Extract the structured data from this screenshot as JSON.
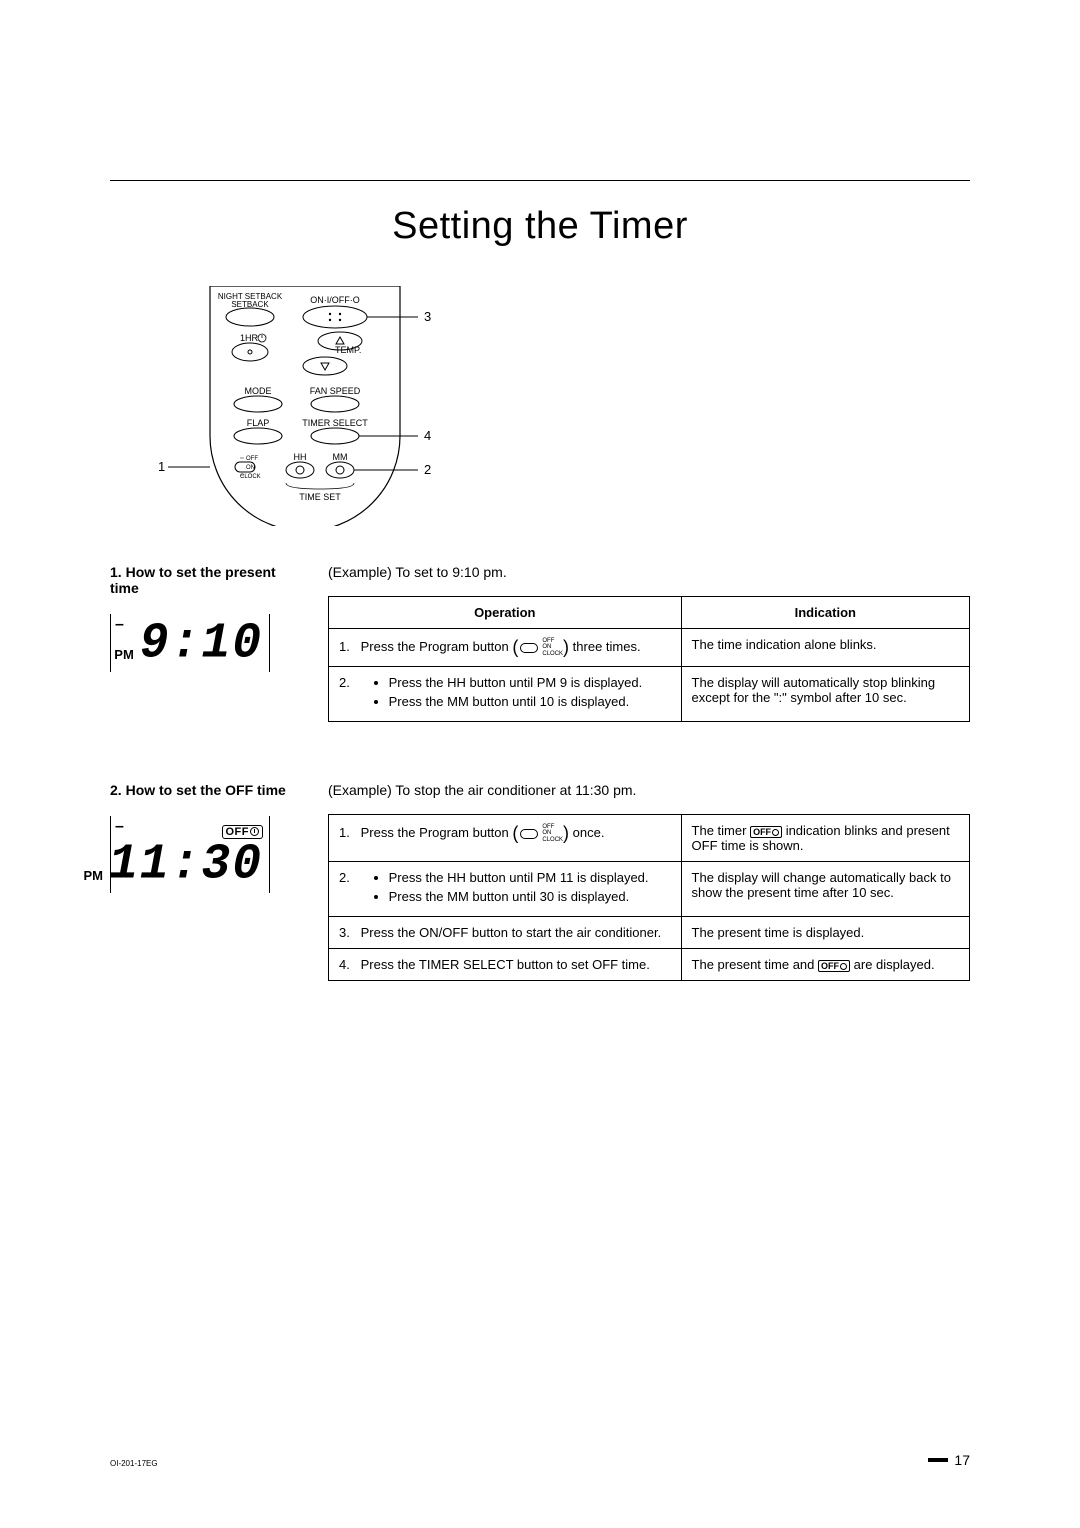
{
  "title": "Setting the Timer",
  "remote": {
    "labels": {
      "night_setback": "NIGHT\nSETBACK",
      "on_off": "ON·I/OFF·O",
      "one_hr": "1HR.",
      "temp": "TEMP.",
      "mode": "MODE",
      "fan_speed": "FAN SPEED",
      "flap": "FLAP",
      "timer_select": "TIMER SELECT",
      "off": "OFF",
      "on": "ON",
      "clock": "CLOCK",
      "hh": "HH",
      "mm": "MM",
      "time_set": "TIME SET"
    },
    "callouts": {
      "c1": "1",
      "c2": "2",
      "c3": "3",
      "c4": "4"
    }
  },
  "section1": {
    "heading_num": "1.",
    "heading": "How to set the present time",
    "example": "(Example) To set to 9:10 pm.",
    "display": {
      "minus": "–",
      "pm": "PM",
      "time": "9:10"
    },
    "table": {
      "head_op": "Operation",
      "head_ind": "Indication",
      "rows": [
        {
          "op_num": "1.",
          "op_pre": "Press the Program button ",
          "op_post": " three times.",
          "prog_labels": {
            "off": "OFF",
            "on": "ON",
            "clock": "CLOCK"
          },
          "ind": "The time indication alone blinks."
        },
        {
          "op_num": "2.",
          "op_bullets": [
            "Press the HH button until PM 9 is displayed.",
            "Press the MM button until 10 is displayed."
          ],
          "ind": "The display will automatically stop blinking except for the \":\" symbol after 10 sec."
        }
      ]
    }
  },
  "section2": {
    "heading_num": "2.",
    "heading": "How to set the OFF time",
    "example": "(Example) To stop the air conditioner at 11:30 pm.",
    "display": {
      "minus": "–",
      "off_badge": "OFF",
      "pm": "PM",
      "time": "11:30"
    },
    "table": {
      "rows": [
        {
          "op_num": "1.",
          "op_pre": "Press the Program button ",
          "op_post": " once.",
          "prog_labels": {
            "off": "OFF",
            "on": "ON",
            "clock": "CLOCK"
          },
          "ind_pre": "The timer ",
          "ind_badge": "OFF",
          "ind_post": " indication blinks and present OFF time is shown."
        },
        {
          "op_num": "2.",
          "op_bullets": [
            "Press the HH button until PM 11 is displayed.",
            "Press the MM button until 30 is displayed."
          ],
          "ind": "The display will change automatically back to show the present time after 10 sec."
        },
        {
          "op_num": "3.",
          "op_text": "Press the ON/OFF button to start the air conditioner.",
          "ind": "The present time is displayed."
        },
        {
          "op_num": "4.",
          "op_text": "Press the TIMER SELECT button to set OFF time.",
          "ind_pre": "The present time and ",
          "ind_badge": "OFF",
          "ind_post": " are displayed."
        }
      ]
    }
  },
  "footer": {
    "doc_id": "OI-201-17EG",
    "page": "17"
  }
}
